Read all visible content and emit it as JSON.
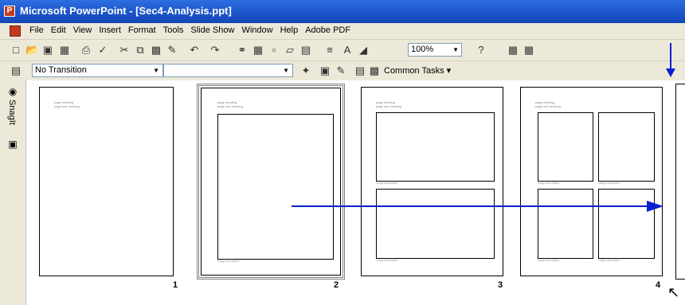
{
  "window": {
    "title": "Microsoft PowerPoint - [Sec4-Analysis.ppt]"
  },
  "menu": [
    "File",
    "Edit",
    "View",
    "Insert",
    "Format",
    "Tools",
    "Slide Show",
    "Window",
    "Help",
    "Adobe PDF"
  ],
  "toolbar": {
    "zoom": "100%",
    "transition": "No Transition",
    "common_tasks": "Common Tasks ▾"
  },
  "sidebar": {
    "snagit_label": "SnagIt"
  },
  "slides": [
    {
      "number": "1",
      "heading": "page heading",
      "subheading": "page sub heading"
    },
    {
      "number": "2",
      "heading": "page heading",
      "subheading": "page sub heading",
      "caption": "image description"
    },
    {
      "number": "3",
      "heading": "page heading",
      "subheading": "page sub heading",
      "captions": [
        "image description",
        "image description"
      ]
    },
    {
      "number": "4",
      "heading": "page heading",
      "subheading": "page sub heading",
      "captions": [
        "image description",
        "image description",
        "image description",
        "image description"
      ]
    }
  ],
  "annotation_colors": {
    "arrow": "#0a1fd0"
  }
}
